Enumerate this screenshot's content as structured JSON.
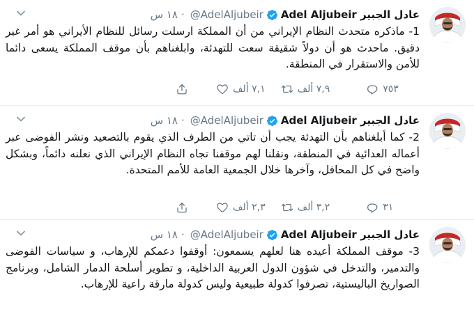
{
  "tweets": [
    {
      "name": "عادل الجبير Adel Aljubeir",
      "handle": "@AdelAljubeir",
      "time": "١٨ س",
      "text": "1- ماذكره متحدث النظام الإيراني من أن المملكة ارسلت رسائل للنظام الأيراني هو أمر غير دقيق. ماحدث هو أن دولاً شقيقة سعت للتهدئة، وابلغناهم بأن موقف المملكة يسعى دائما للأمن والاستقرار  في المنطقة.",
      "replies": "٧٥٣",
      "retweets": "٧,٩ ألف",
      "likes": "٧,١ ألف"
    },
    {
      "name": "عادل الجبير Adel Aljubeir",
      "handle": "@AdelAljubeir",
      "time": "١٨ س",
      "text": "2- كما أبلغناهم بأن التهدئة يجب أن تاتي من الطرف الذي يقوم بالتصعيد ونشر الفوضى عبر أعماله العدائية في المنطقة، ونقلنا لهم موقفنا تجاه النظام الإيراني الذي نعلنه دائماً، وبشكل واضح في كل المحافل، وآخرها خلال الجمعية العامة للأمم المتحدة.",
      "replies": "٣١",
      "retweets": "٣,٢ ألف",
      "likes": "٢,٣ ألف"
    },
    {
      "name": "عادل الجبير Adel Aljubeir",
      "handle": "@AdelAljubeir",
      "time": "١٨ س",
      "text": "3- موقف المملكة أعيده هنا لعلهم يسمعون: أوقفوا دعمكم للإرهاب، و سياسات الفوضى والتدمير، والتدخل في شؤون الدول العربية الداخلية، و تطوير أسلحة الدمار الشامل، وبرنامج الصواريخ الباليستية، تصرفوا كدولة طبيعية وليس كدولة مارقة راعية للإرهاب."
    }
  ],
  "icons": {
    "verified": "verified-badge-icon",
    "caret": "chevron-down-icon",
    "reply": "reply-icon",
    "retweet": "retweet-icon",
    "like": "heart-icon",
    "share": "share-icon"
  },
  "colors": {
    "verified": "#1da1f2",
    "text": "#14171a",
    "muted": "#657786",
    "divider": "#e6ecf0"
  }
}
